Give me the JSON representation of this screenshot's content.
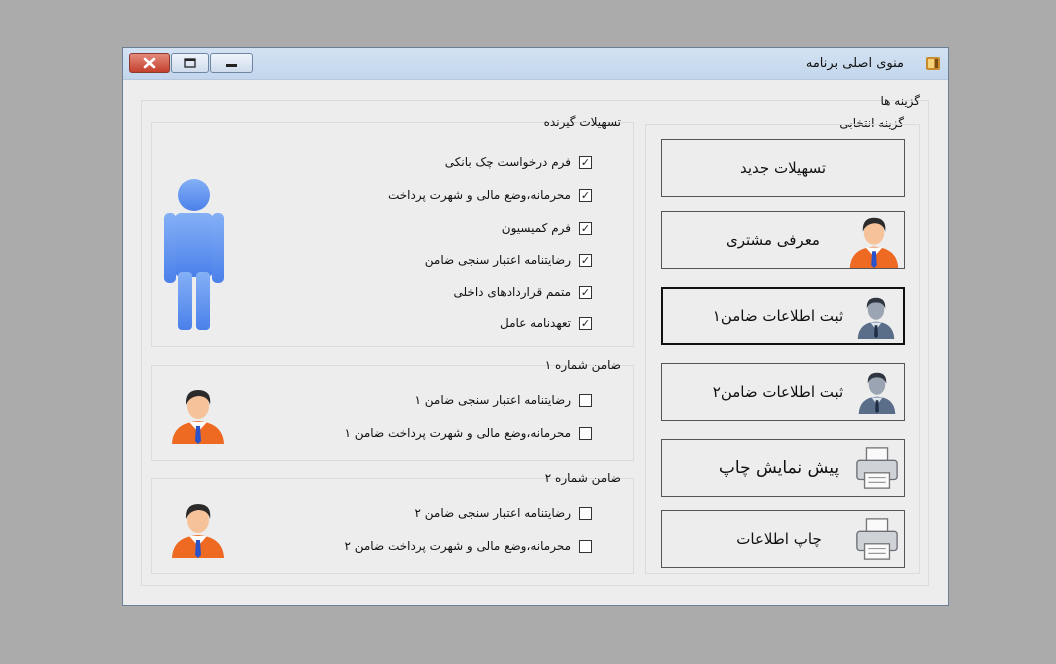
{
  "window": {
    "title": "منوی اصلی برنامه"
  },
  "options_group": {
    "title": "گزینه ها",
    "subtitle": "گزینه انتخابی"
  },
  "buttons": [
    {
      "label": "تسهیلات جدید",
      "icon": "none"
    },
    {
      "label": "معرفی مشتری",
      "icon": "person-icon"
    },
    {
      "label": "ثبت اطلاعات ضامن۱",
      "icon": "user-dark-icon"
    },
    {
      "label": "ثبت اطلاعات ضامن۲",
      "icon": "user-dark-icon"
    },
    {
      "label": "پیش نمایش چاپ",
      "icon": "printer-icon"
    },
    {
      "label": "چاپ اطلاعات",
      "icon": "printer-icon"
    }
  ],
  "borrower": {
    "title": "تسهیلات گیرنده",
    "items": [
      {
        "label": "فرم درخواست چک بانکی",
        "checked": true
      },
      {
        "label": "محرمانه،وضع مالی و شهرت پرداخت",
        "checked": true
      },
      {
        "label": "فرم کمیسیون",
        "checked": true
      },
      {
        "label": "رضایتنامه اعتبار سنجی  ضامن",
        "checked": true
      },
      {
        "label": "متمم قراردادهای داخلی",
        "checked": true
      },
      {
        "label": "تعهدنامه عامل",
        "checked": true
      }
    ]
  },
  "guarantor1": {
    "title": "ضامن شماره ۱",
    "items": [
      {
        "label": "رضایتنامه اعتبار سنجی  ضامن ۱",
        "checked": false
      },
      {
        "label": "محرمانه،وضع مالی و شهرت پرداخت ضامن ۱",
        "checked": false
      }
    ]
  },
  "guarantor2": {
    "title": "ضامن شماره ۲",
    "items": [
      {
        "label": "رضایتنامه اعتبار سنجی  ضامن ۲",
        "checked": false
      },
      {
        "label": "محرمانه،وضع مالی و شهرت پرداخت ضامن ۲",
        "checked": false
      }
    ]
  },
  "colors": {
    "accent": "#5b8ef0",
    "person_orange": "#ee6a22"
  }
}
